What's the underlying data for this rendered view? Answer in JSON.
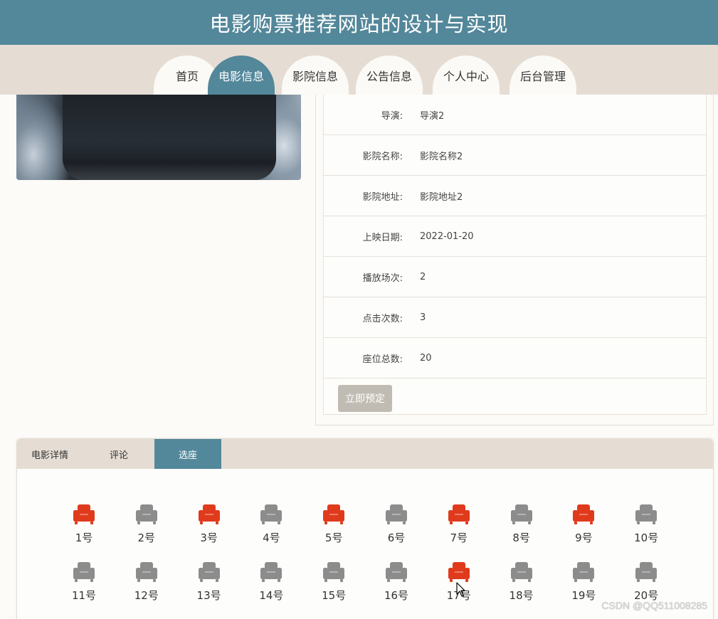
{
  "header": {
    "title": "电影购票推荐网站的设计与实现"
  },
  "nav": {
    "items": [
      {
        "label": "首页",
        "active": false
      },
      {
        "label": "电影信息",
        "active": true
      },
      {
        "label": "影院信息",
        "active": false
      },
      {
        "label": "公告信息",
        "active": false
      },
      {
        "label": "个人中心",
        "active": false
      },
      {
        "label": "后台管理",
        "active": false
      }
    ]
  },
  "details": {
    "rows": [
      {
        "label": "导演:",
        "value": "导演2"
      },
      {
        "label": "影院名称:",
        "value": "影院名称2"
      },
      {
        "label": "影院地址:",
        "value": "影院地址2"
      },
      {
        "label": "上映日期:",
        "value": "2022-01-20"
      },
      {
        "label": "播放场次:",
        "value": "2"
      },
      {
        "label": "点击次数:",
        "value": "3"
      },
      {
        "label": "座位总数:",
        "value": "20"
      }
    ],
    "book_button": "立即预定"
  },
  "tabs": [
    {
      "label": "电影详情",
      "active": false
    },
    {
      "label": "评论",
      "active": false
    },
    {
      "label": "选座",
      "active": true
    }
  ],
  "seats": [
    {
      "label": "1号",
      "status": "taken"
    },
    {
      "label": "2号",
      "status": "available"
    },
    {
      "label": "3号",
      "status": "taken"
    },
    {
      "label": "4号",
      "status": "available"
    },
    {
      "label": "5号",
      "status": "taken"
    },
    {
      "label": "6号",
      "status": "available"
    },
    {
      "label": "7号",
      "status": "taken"
    },
    {
      "label": "8号",
      "status": "available"
    },
    {
      "label": "9号",
      "status": "taken"
    },
    {
      "label": "10号",
      "status": "available"
    },
    {
      "label": "11号",
      "status": "available"
    },
    {
      "label": "12号",
      "status": "available"
    },
    {
      "label": "13号",
      "status": "available"
    },
    {
      "label": "14号",
      "status": "available"
    },
    {
      "label": "15号",
      "status": "available"
    },
    {
      "label": "16号",
      "status": "available"
    },
    {
      "label": "17号",
      "status": "taken"
    },
    {
      "label": "18号",
      "status": "available"
    },
    {
      "label": "19号",
      "status": "available"
    },
    {
      "label": "20号",
      "status": "available"
    }
  ],
  "colors": {
    "primary": "#53879a",
    "nav_bg": "#e5ddd3",
    "seat_taken": "#e03a1c",
    "seat_available": "#8c8c8c",
    "button_disabled": "#c1bcb3"
  },
  "icons": {
    "seat": "armchair-icon",
    "cursor": "mouse-pointer-icon"
  },
  "watermark": "CSDN @QQ511008285"
}
